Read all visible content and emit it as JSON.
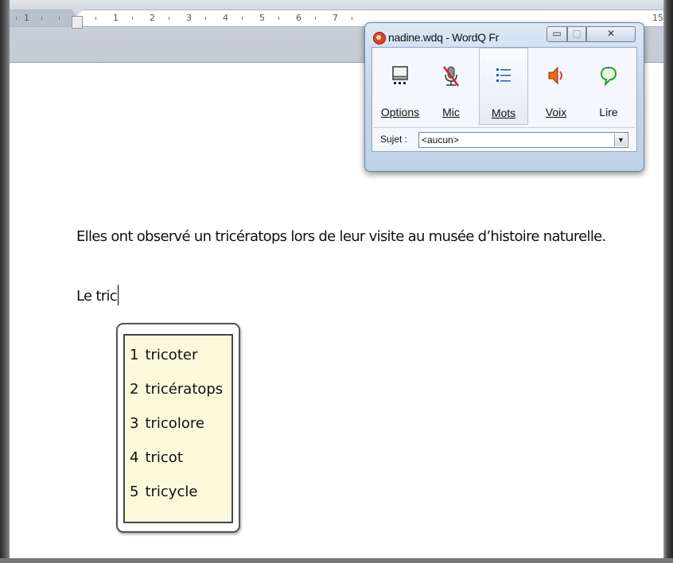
{
  "ruler": {
    "numbers": [
      "1",
      "1",
      "2",
      "3",
      "4",
      "5",
      "6",
      "7",
      "15"
    ]
  },
  "wordq": {
    "title": "nadine.wdq - WordQ Fr",
    "window_buttons": {
      "minimize": "▭",
      "maximize": "▢",
      "close": "✕"
    },
    "tools": [
      {
        "label": "Options",
        "icon": "options-icon"
      },
      {
        "label": "Mic",
        "icon": "microphone-muted-icon"
      },
      {
        "label": "Mots",
        "icon": "word-list-icon"
      },
      {
        "label": "Voix",
        "icon": "speaker-icon"
      },
      {
        "label": "Lire",
        "icon": "speech-bubble-icon"
      }
    ],
    "subject_label": "Sujet :",
    "subject_value": "<aucun>"
  },
  "document": {
    "line1": "Elles ont observé  un tricératops lors de leur visite au musée d’histoire naturelle.",
    "line2": "Le tric"
  },
  "predictions": [
    {
      "num": "1",
      "word": "tricoter"
    },
    {
      "num": "2",
      "word": "tricératops"
    },
    {
      "num": "3",
      "word": "tricolore"
    },
    {
      "num": "4",
      "word": "tricot"
    },
    {
      "num": "5",
      "word": "tricycle"
    }
  ],
  "colors": {
    "prediction_bg": "#fbf9dc",
    "window_bg": "#c7d8ec"
  }
}
